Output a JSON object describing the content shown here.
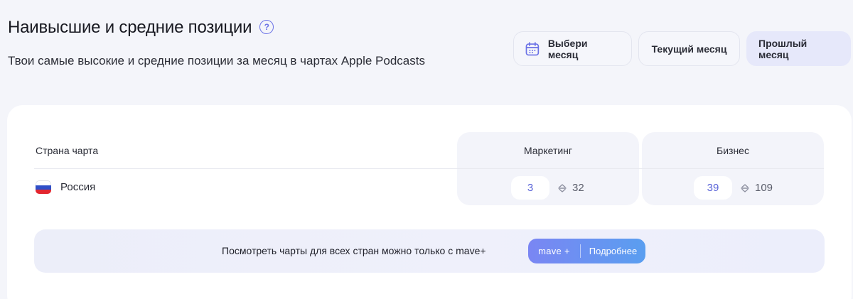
{
  "header": {
    "title": "Наивысшие и средние позиции",
    "help_icon": "question-circle-icon",
    "subtitle": "Твои самые высокие и средние позиции за месяц в чартах Apple Podcasts"
  },
  "period_buttons": {
    "pick_month": "Выбери месяц",
    "pick_month_icon": "calendar-icon",
    "current_month": "Текущий месяц",
    "last_month": "Прошлый месяц",
    "selected": "Прошлый месяц"
  },
  "table": {
    "headers": {
      "country": "Страна чарта",
      "categories": [
        "Маркетинг",
        "Бизнес"
      ]
    },
    "rows": [
      {
        "flag_icon": "russia-flag-icon",
        "country": "Россия",
        "positions": [
          {
            "best": "3",
            "avg": "32"
          },
          {
            "best": "39",
            "avg": "109"
          }
        ]
      }
    ]
  },
  "promo": {
    "text": "Посмотреть чарты для всех стран можно только с mave+",
    "brand": "mave +",
    "more": "Подробнее"
  },
  "colors": {
    "accent": "#6b72e6",
    "page_bg": "#f4f5fa",
    "selected_button_bg": "#e6e8fa",
    "promo_gradient_start": "#7a86f3",
    "promo_gradient_end": "#5a9ef0"
  }
}
